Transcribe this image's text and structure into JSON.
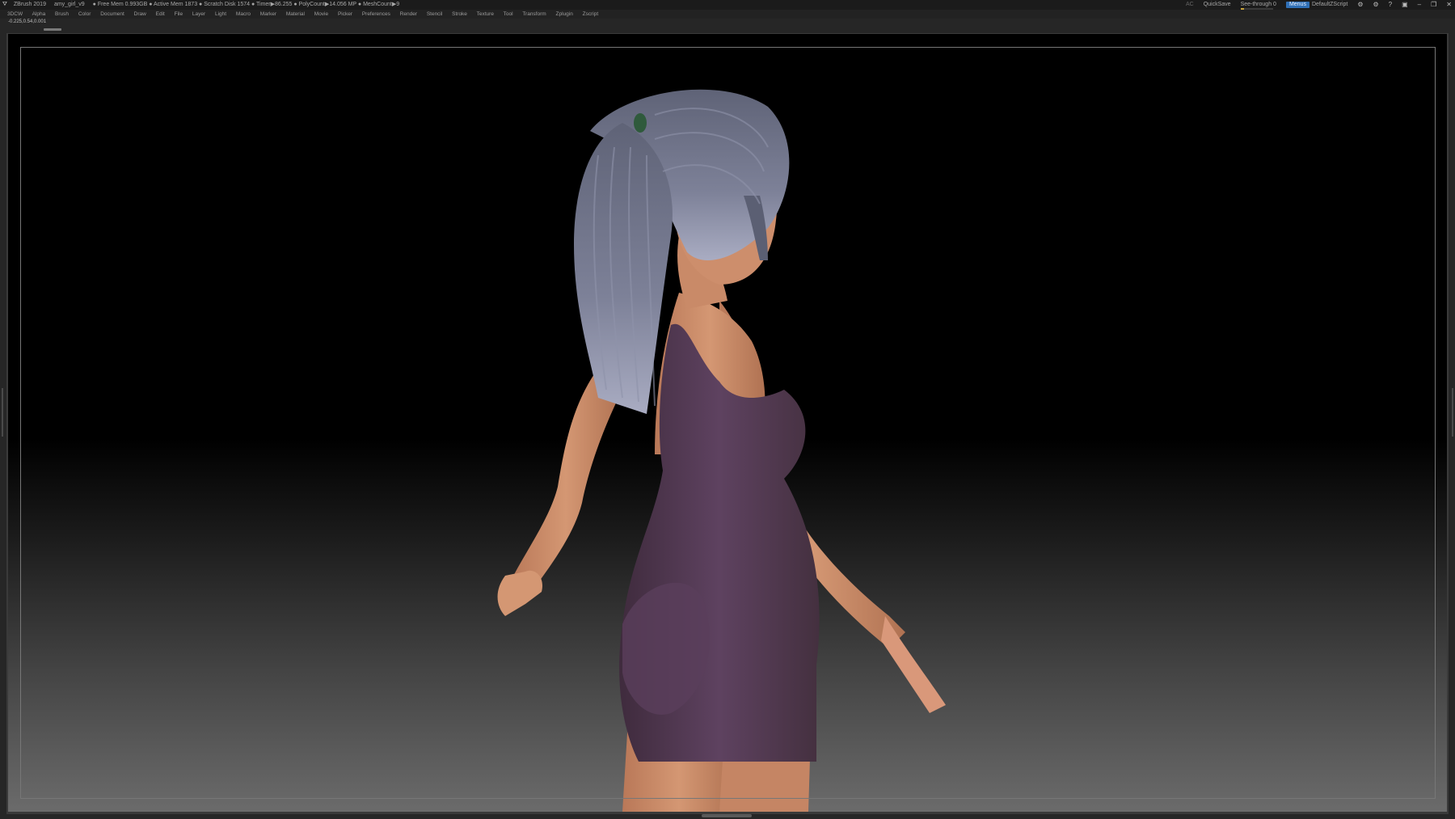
{
  "titlebar": {
    "app": "ZBrush 2019",
    "file": "amy_girl_v9",
    "stats": "● Free Mem 0.993GB ● Active Mem 1873 ● Scratch Disk 1574 ● Timer▶86.255 ● PolyCount▶14.056 MP ● MeshCount▶9",
    "ac": "AC",
    "quicksave": "QuickSave",
    "see_through": "See-through 0",
    "see_through_level": 0,
    "menus": "Menus",
    "script": "DefaultZScript"
  },
  "menubar": [
    "3DCW",
    "Alpha",
    "Brush",
    "Color",
    "Document",
    "Draw",
    "Edit",
    "File",
    "Layer",
    "Light",
    "Macro",
    "Marker",
    "Material",
    "Movie",
    "Picker",
    "Preferences",
    "Render",
    "Stencil",
    "Stroke",
    "Texture",
    "Tool",
    "Transform",
    "Zplugin",
    "Zscript"
  ],
  "coords": "-0.225,0.54,0.001",
  "colors": {
    "accent": "#2f6fb5",
    "skin": "#c98a68",
    "dress": "#51384f",
    "hair": "#6f7388"
  }
}
